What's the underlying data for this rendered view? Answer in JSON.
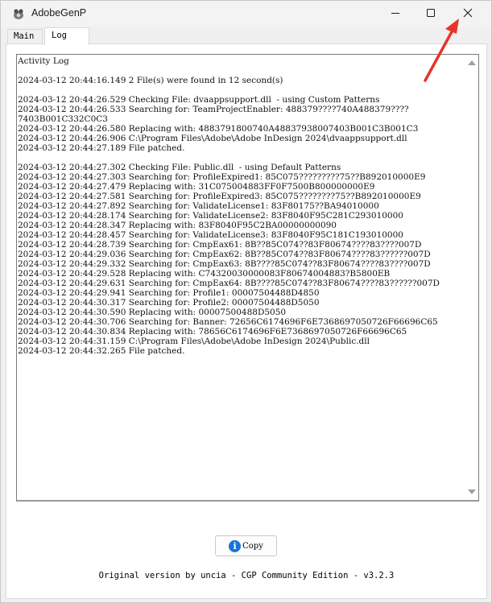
{
  "window": {
    "title": "AdobeGenP",
    "icon": "app-icon",
    "controls": {
      "minimize": "minimize-icon",
      "maximize": "maximize-icon",
      "close": "close-icon"
    }
  },
  "tabs": [
    {
      "label": "Main",
      "active": false
    },
    {
      "label": "Log",
      "active": true
    }
  ],
  "log": {
    "lines": [
      "Activity Log",
      "",
      "2024-03-12 20:44:16.149 2 File(s) were found in 12 second(s)",
      "",
      "2024-03-12 20:44:26.529 Checking File: dvaappsupport.dll  - using Custom Patterns",
      "2024-03-12 20:44:26.533 Searching for: TeamProjectEnabler: 488379????740A488379????",
      "7403B001C332C0C3",
      "2024-03-12 20:44:26.580 Replacing with: 4883791800740A48837938007403B001C3B001C3",
      "2024-03-12 20:44:26.906 C:\\Program Files\\Adobe\\Adobe InDesign 2024\\dvaappsupport.dll",
      "2024-03-12 20:44:27.189 File patched.",
      "",
      "2024-03-12 20:44:27.302 Checking File: Public.dll  - using Default Patterns",
      "2024-03-12 20:44:27.303 Searching for: ProfileExpired1: 85C075?????????75??B892010000E9",
      "2024-03-12 20:44:27.479 Replacing with: 31C075004883FF0F7500B800000000E9",
      "2024-03-12 20:44:27.581 Searching for: ProfileExpired3: 85C075????????75??B892010000E9",
      "2024-03-12 20:44:27.892 Searching for: ValidateLicense1: 83F80175??BA94010000",
      "2024-03-12 20:44:28.174 Searching for: ValidateLicense2: 83F8040F95C281C293010000",
      "2024-03-12 20:44:28.347 Replacing with: 83F8040F95C2BA00000000090",
      "2024-03-12 20:44:28.457 Searching for: ValidateLicense3: 83F8040F95C181C193010000",
      "2024-03-12 20:44:28.739 Searching for: CmpEax61: 8B??85C074??83F80674????83????007D",
      "2024-03-12 20:44:29.036 Searching for: CmpEax62: 8B??85C074??83F80674????83??????007D",
      "2024-03-12 20:44:29.332 Searching for: CmpEax63: 8B????85C074??83F80674????83????007D",
      "2024-03-12 20:44:29.528 Replacing with: C74320030000083F80674004883?B5800EB",
      "2024-03-12 20:44:29.631 Searching for: CmpEax64: 8B????85C074??83F80674????83??????007D",
      "2024-03-12 20:44:29.941 Searching for: Profile1: 00007504488D4850",
      "2024-03-12 20:44:30.317 Searching for: Profile2: 00007504488D5050",
      "2024-03-12 20:44:30.590 Replacing with: 00007500488D5050",
      "2024-03-12 20:44:30.706 Searching for: Banner: 72656C6174696F6E7368697050726F66696C65",
      "2024-03-12 20:44:30.834 Replacing with: 78656C6174696F6E7368697050726F66696C65",
      "2024-03-12 20:44:31.159 C:\\Program Files\\Adobe\\Adobe InDesign 2024\\Public.dll",
      "2024-03-12 20:44:32.265 File patched."
    ]
  },
  "copy_button": {
    "label": "Copy",
    "icon": "info-icon",
    "icon_glyph": "i"
  },
  "footer": {
    "text": "Original version by uncia - CGP Community Edition - v3.2.3"
  },
  "annotation": {
    "arrow_color": "#e8332a",
    "icon": "arrow-pointer-icon"
  }
}
